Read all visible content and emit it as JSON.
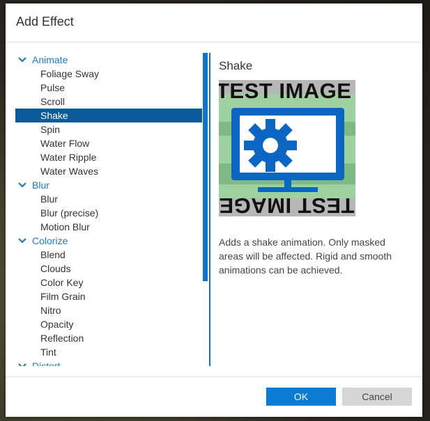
{
  "dialog": {
    "title": "Add Effect"
  },
  "tree": [
    {
      "type": "category",
      "label": "Animate"
    },
    {
      "type": "leaf",
      "label": "Foliage Sway"
    },
    {
      "type": "leaf",
      "label": "Pulse"
    },
    {
      "type": "leaf",
      "label": "Scroll"
    },
    {
      "type": "leaf",
      "label": "Shake",
      "selected": true
    },
    {
      "type": "leaf",
      "label": "Spin"
    },
    {
      "type": "leaf",
      "label": "Water Flow"
    },
    {
      "type": "leaf",
      "label": "Water Ripple"
    },
    {
      "type": "leaf",
      "label": "Water Waves"
    },
    {
      "type": "category",
      "label": "Blur"
    },
    {
      "type": "leaf",
      "label": "Blur"
    },
    {
      "type": "leaf",
      "label": "Blur (precise)"
    },
    {
      "type": "leaf",
      "label": "Motion Blur"
    },
    {
      "type": "category",
      "label": "Colorize"
    },
    {
      "type": "leaf",
      "label": "Blend"
    },
    {
      "type": "leaf",
      "label": "Clouds"
    },
    {
      "type": "leaf",
      "label": "Color Key"
    },
    {
      "type": "leaf",
      "label": "Film Grain"
    },
    {
      "type": "leaf",
      "label": "Nitro"
    },
    {
      "type": "leaf",
      "label": "Opacity"
    },
    {
      "type": "leaf",
      "label": "Reflection"
    },
    {
      "type": "leaf",
      "label": "Tint"
    },
    {
      "type": "category",
      "label": "Distort"
    }
  ],
  "detail": {
    "title": "Shake",
    "preview_text": "TEST IMAGE",
    "description": "Adds a shake animation. Only masked areas will be affected. Rigid and smooth animations can be achieved."
  },
  "buttons": {
    "ok": "OK",
    "cancel": "Cancel"
  },
  "colors": {
    "accent": "#0b7bd4",
    "selected": "#0b5a99",
    "category": "#1a7ac8"
  }
}
